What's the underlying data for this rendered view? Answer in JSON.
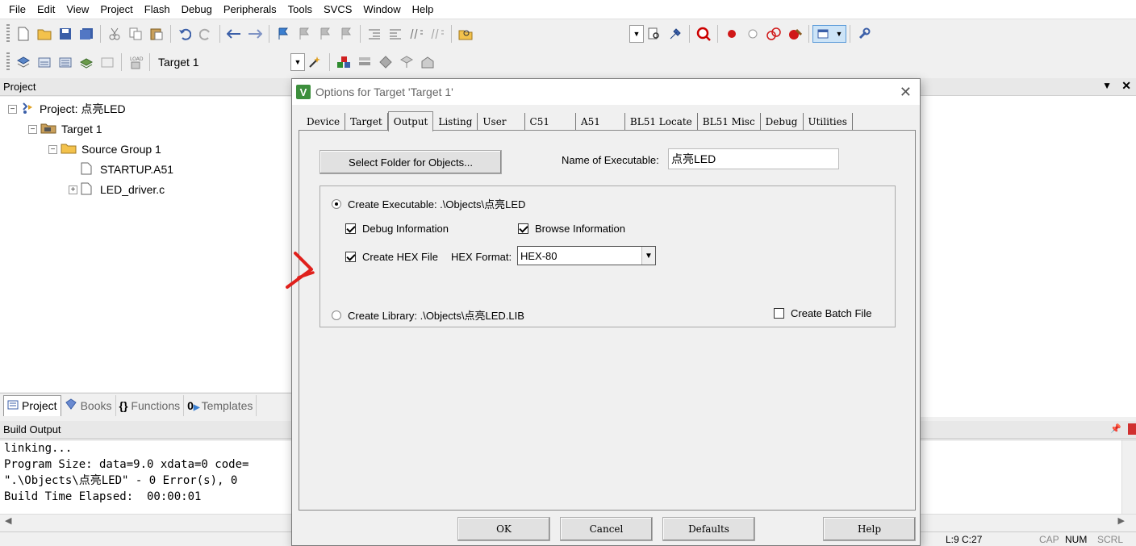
{
  "menu": [
    "File",
    "Edit",
    "View",
    "Project",
    "Flash",
    "Debug",
    "Peripherals",
    "Tools",
    "SVCS",
    "Window",
    "Help"
  ],
  "toolbar2": {
    "target": "Target 1"
  },
  "project_pane": {
    "title": "Project",
    "tree": {
      "project": "Project: 点亮LED",
      "target": "Target 1",
      "group": "Source Group 1",
      "file1": "STARTUP.A51",
      "file2": "LED_driver.c"
    }
  },
  "bottom_tabs": [
    "Project",
    "Books",
    "Functions",
    "Templates"
  ],
  "build_output": {
    "title": "Build Output",
    "lines": [
      "linking...",
      "Program Size: data=9.0 xdata=0 code=",
      "\".\\Objects\\点亮LED\" - 0 Error(s), 0",
      "Build Time Elapsed:  00:00:01"
    ]
  },
  "status": {
    "position": "L:9 C:27",
    "cap": "CAP",
    "num": "NUM",
    "scrl": "SCRL"
  },
  "dialog": {
    "title": "Options for Target 'Target 1'",
    "tabs": [
      "Device",
      "Target",
      "Output",
      "Listing",
      "User",
      "C51",
      "A51",
      "BL51 Locate",
      "BL51 Misc",
      "Debug",
      "Utilities"
    ],
    "active_tab": "Output",
    "select_folder_label": "Select Folder for Objects...",
    "name_exec_label": "Name of Executable:",
    "name_exec_value": "点亮LED",
    "create_exec_label": "Create Executable:  .\\Objects\\点亮LED",
    "debug_info_label": "Debug Information",
    "browse_info_label": "Browse Information",
    "create_hex_label": "Create HEX File",
    "hex_format_label": "HEX Format:",
    "hex_format_value": "HEX-80",
    "create_lib_label": "Create Library:  .\\Objects\\点亮LED.LIB",
    "create_batch_label": "Create Batch File",
    "buttons": {
      "ok": "OK",
      "cancel": "Cancel",
      "defaults": "Defaults",
      "help": "Help"
    }
  },
  "colors": {
    "annotation": "#e0201c",
    "dialog_icon": "#3d8f3d"
  }
}
